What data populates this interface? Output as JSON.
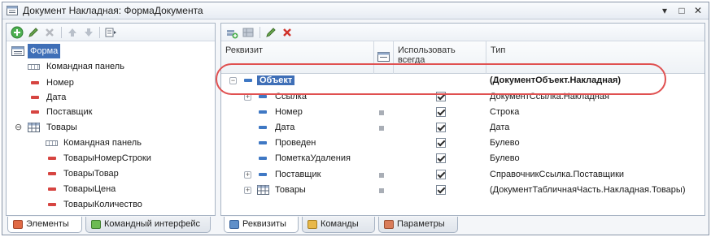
{
  "window": {
    "title": "Документ Накладная: ФормаДокумента",
    "controls": {
      "menu": "▾",
      "maximize": "□",
      "close": "✕"
    }
  },
  "left_toolbar": {
    "icons": [
      "add-icon",
      "edit-icon",
      "delete-icon",
      "move-up-icon",
      "move-down-icon",
      "more-icon"
    ]
  },
  "left_tree": {
    "root": "Форма",
    "items": [
      {
        "label": "Командная панель",
        "icon": "command-panel-icon"
      },
      {
        "label": "Номер",
        "icon": "field-icon"
      },
      {
        "label": "Дата",
        "icon": "field-icon"
      },
      {
        "label": "Поставщик",
        "icon": "field-icon"
      },
      {
        "label": "Товары",
        "icon": "table-icon"
      },
      {
        "label": "Командная панель",
        "icon": "command-panel-icon"
      },
      {
        "label": "ТоварыНомерСтроки",
        "icon": "field-icon"
      },
      {
        "label": "ТоварыТовар",
        "icon": "field-icon"
      },
      {
        "label": "ТоварыЦена",
        "icon": "field-icon"
      },
      {
        "label": "ТоварыКоличество",
        "icon": "field-icon"
      }
    ]
  },
  "left_tabs": [
    {
      "label": "Элементы",
      "active": true
    },
    {
      "label": "Командный интерфейс",
      "active": false
    }
  ],
  "right_toolbar": {
    "icons": [
      "add-attribute-icon",
      "add-table-icon",
      "edit-icon",
      "delete-icon"
    ]
  },
  "grid": {
    "headers": {
      "attribute": "Реквизит",
      "use_always": "Использовать всегда",
      "type": "Тип"
    },
    "rows": [
      {
        "name": "Объект",
        "type": "(ДокументОбъект.Накладная)",
        "expander": "−",
        "checked": false,
        "grey": false
      },
      {
        "name": "Ссылка",
        "type": "ДокументСсылка.Накладная",
        "expander": "+",
        "checked": true,
        "grey": false
      },
      {
        "name": "Номер",
        "type": "Строка",
        "expander": "",
        "checked": true,
        "grey": true
      },
      {
        "name": "Дата",
        "type": "Дата",
        "expander": "",
        "checked": true,
        "grey": true
      },
      {
        "name": "Проведен",
        "type": "Булево",
        "expander": "",
        "checked": true,
        "grey": false
      },
      {
        "name": "ПометкаУдаления",
        "type": "Булево",
        "expander": "",
        "checked": true,
        "grey": false
      },
      {
        "name": "Поставщик",
        "type": "СправочникСсылка.Поставщики",
        "expander": "+",
        "checked": true,
        "grey": true
      },
      {
        "name": "Товары",
        "type": "(ДокументТабличнаяЧасть.Накладная.Товары)",
        "expander": "+",
        "checked": true,
        "grey": true
      }
    ]
  },
  "right_tabs": [
    {
      "label": "Реквизиты",
      "active": true
    },
    {
      "label": "Команды",
      "active": false
    },
    {
      "label": "Параметры",
      "active": false
    }
  ],
  "colors": {
    "selection": "#3f6fb7",
    "highlight_oval": "#e05050",
    "field_icon_red": "#d64541",
    "field_icon_blue": "#3f78c4"
  }
}
